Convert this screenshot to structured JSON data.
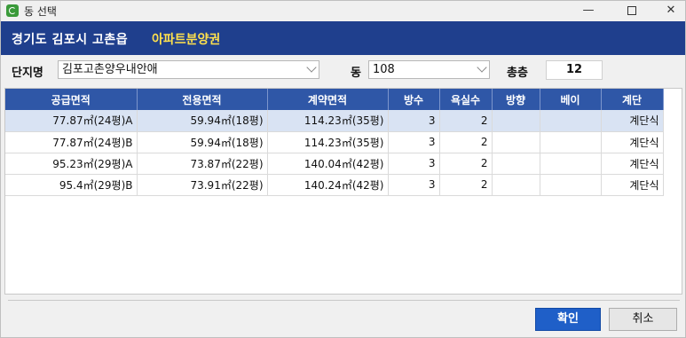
{
  "window": {
    "title": "동 선택",
    "minimize": "—",
    "close": "✕"
  },
  "banner": {
    "main": "경기도 김포시 고촌읍",
    "accent": "아파트분양권"
  },
  "filters": {
    "complex_label": "단지명",
    "complex_value": "김포고촌양우내안애",
    "building_label": "동",
    "building_value": "108",
    "floors_label": "총층",
    "floors_value": "12"
  },
  "table": {
    "columns": [
      "공급면적",
      "전용면적",
      "계약면적",
      "방수",
      "욕실수",
      "방향",
      "베이",
      "계단"
    ],
    "rows": [
      [
        "77.87㎡(24평)A",
        "59.94㎡(18평)",
        "114.23㎡(35평)",
        "3",
        "2",
        "",
        "",
        "계단식"
      ],
      [
        "77.87㎡(24평)B",
        "59.94㎡(18평)",
        "114.23㎡(35평)",
        "3",
        "2",
        "",
        "",
        "계단식"
      ],
      [
        "95.23㎡(29평)A",
        "73.87㎡(22평)",
        "140.04㎡(42평)",
        "3",
        "2",
        "",
        "",
        "계단식"
      ],
      [
        "95.4㎡(29평)B",
        "73.91㎡(22평)",
        "140.24㎡(42평)",
        "3",
        "2",
        "",
        "",
        "계단식"
      ]
    ]
  },
  "buttons": {
    "ok": "확인",
    "cancel": "취소"
  },
  "colors": {
    "banner": "#1f3f8d",
    "accent": "#ffe14d",
    "header": "#2f57a7",
    "selected_row": "#d9e3f3",
    "ok_button": "#1f5fc8"
  }
}
